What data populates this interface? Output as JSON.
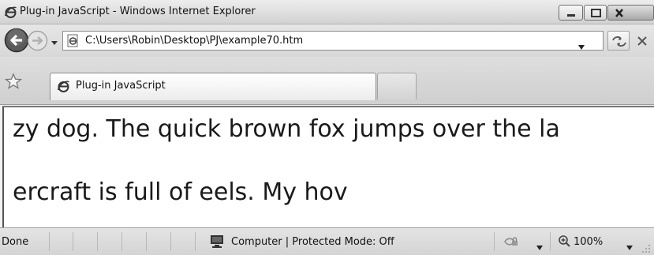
{
  "window": {
    "title": "Plug-in JavaScript - Windows Internet Explorer",
    "app_icon": "ie-icon"
  },
  "caption_buttons": [
    "minimize-icon",
    "maximize-icon",
    "close-icon"
  ],
  "address_bar": {
    "url": "C:\\Users\\Robin\\Desktop\\PJ\\example70.htm",
    "page_icon": "ie-page-icon"
  },
  "nav_icons": [
    "back-arrow-icon",
    "forward-arrow-icon",
    "chevron-down-icon",
    "refresh-icon",
    "stop-icon"
  ],
  "tabs": [
    {
      "label": "Plug-in JavaScript",
      "icon": "ie-page-icon"
    }
  ],
  "content": {
    "line1": "zy dog. The quick brown fox jumps over the la",
    "line2": "ercraft is full of eels. My hov"
  },
  "status_bar": {
    "status": "Done",
    "zone": "Computer | Protected Mode: Off",
    "zoom": "100%"
  },
  "colors": {
    "chrome": "#dadada",
    "content_bg": "#ffffff",
    "text": "#1a1a1a"
  }
}
